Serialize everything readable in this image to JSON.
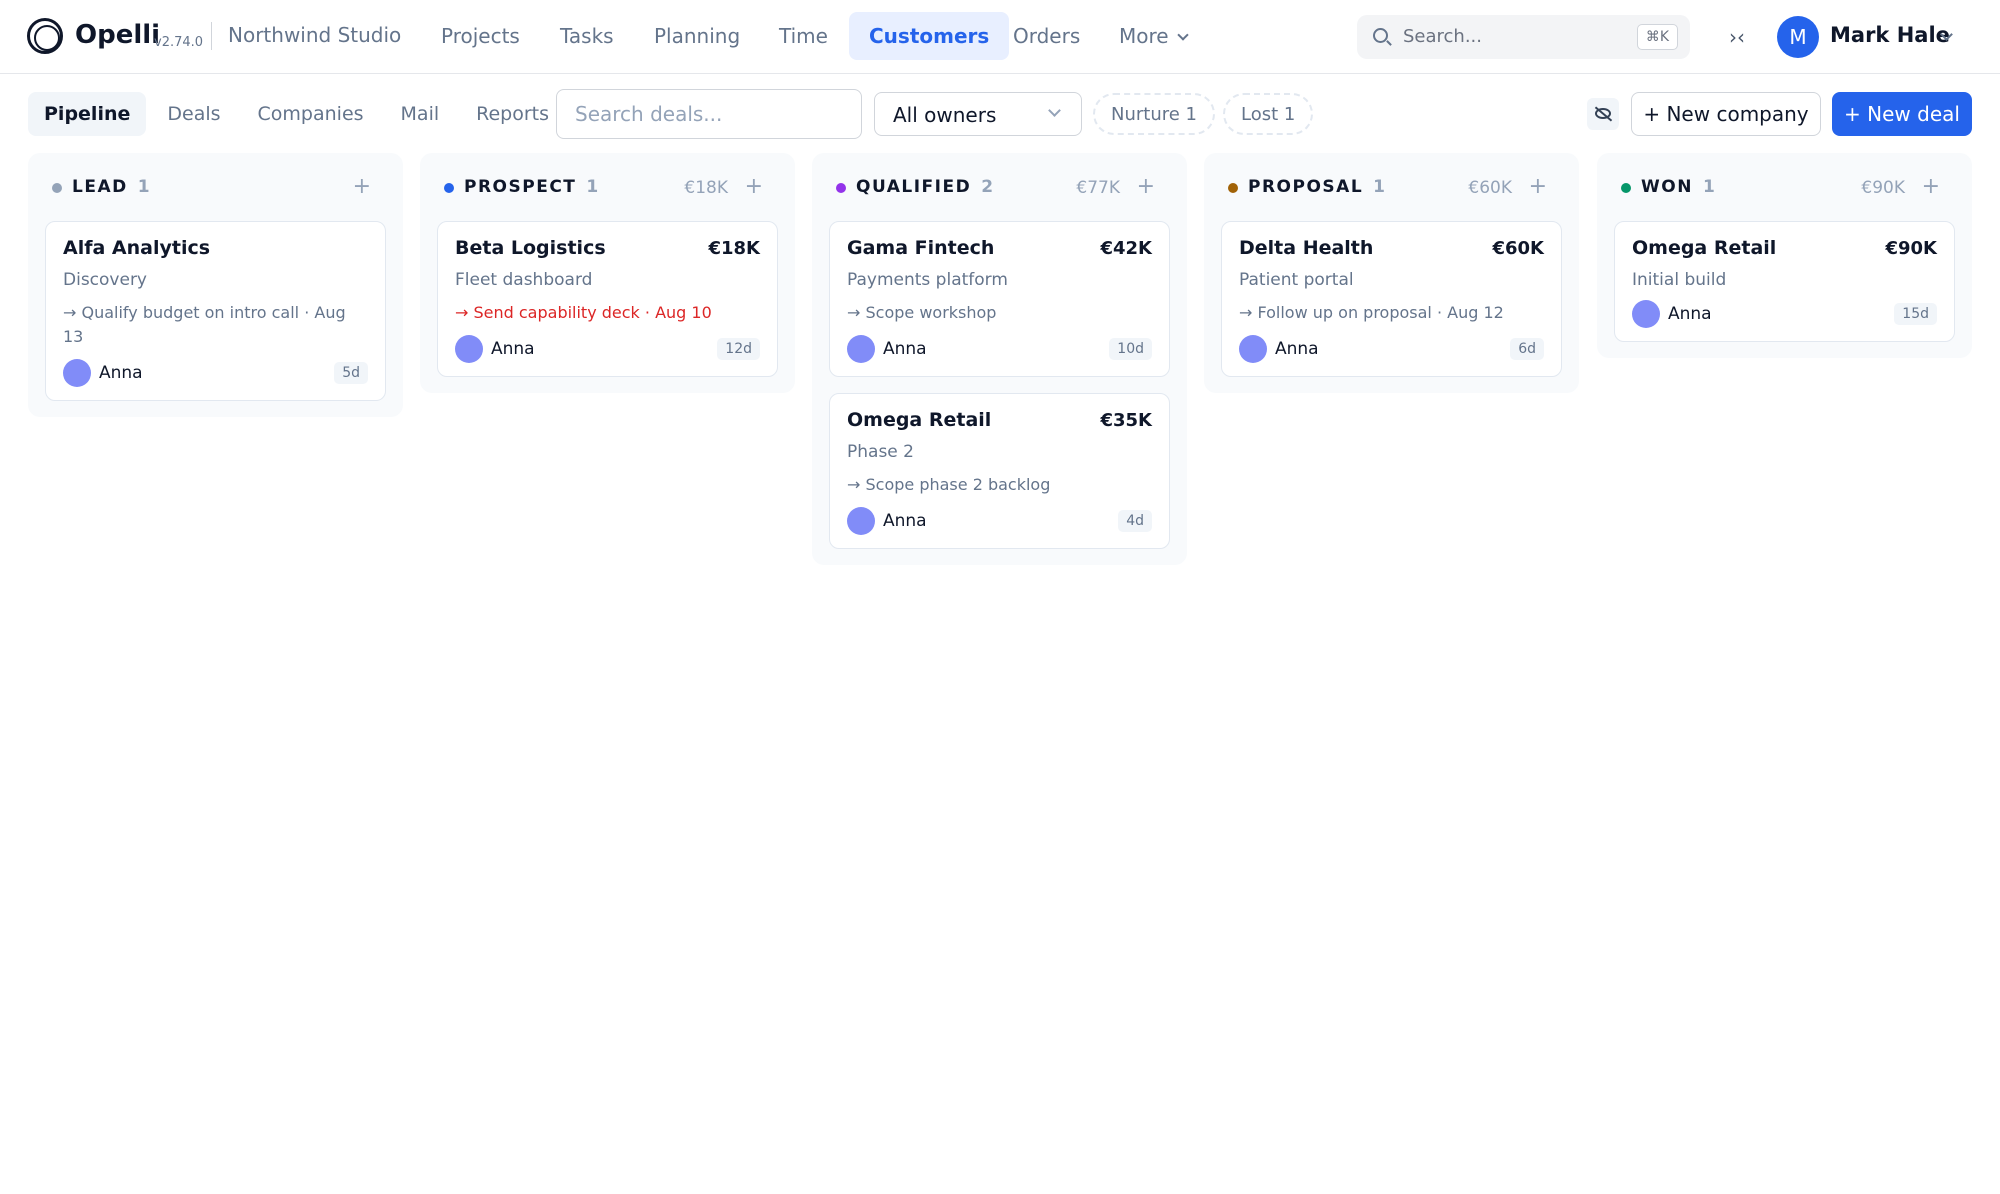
{
  "app": {
    "name": "Opelli",
    "version": "v2.74.0",
    "workspace": "Northwind Studio"
  },
  "nav": {
    "items": [
      {
        "label": "Projects"
      },
      {
        "label": "Tasks"
      },
      {
        "label": "Planning"
      },
      {
        "label": "Time"
      },
      {
        "label": "Customers"
      },
      {
        "label": "Orders"
      },
      {
        "label": "More"
      }
    ],
    "active": "Customers"
  },
  "search": {
    "placeholder": "Search...",
    "shortcut": "⌘K"
  },
  "user": {
    "initial": "M",
    "name": "Mark Hale"
  },
  "subtabs": {
    "items": [
      {
        "label": "Pipeline"
      },
      {
        "label": "Deals"
      },
      {
        "label": "Companies"
      },
      {
        "label": "Mail"
      },
      {
        "label": "Reports"
      }
    ],
    "active": "Pipeline"
  },
  "toolbar": {
    "deal_search_placeholder": "Search deals...",
    "owner_filter": "All owners",
    "pills": [
      {
        "label": "Nurture 1"
      },
      {
        "label": "Lost 1"
      }
    ],
    "new_company_label": "+ New company",
    "new_deal_label": "+ New deal"
  },
  "colors": {
    "accent": "#2563eb",
    "lead": "#94a3b8",
    "prospect": "#2563eb",
    "qualified": "#9333ea",
    "proposal": "#a16207",
    "won": "#059669",
    "overdue": "#dc2626"
  },
  "columns": [
    {
      "name": "LEAD",
      "count": "1",
      "amount": "",
      "cards": [
        {
          "title": "Alfa Analytics",
          "amount": "",
          "subtitle": "Discovery",
          "task": "→ Qualify budget on intro call · Aug 13",
          "owner": "Anna",
          "age": "5d",
          "overdue": false
        }
      ]
    },
    {
      "name": "PROSPECT",
      "count": "1",
      "amount": "€18K",
      "cards": [
        {
          "title": "Beta Logistics",
          "amount": "€18K",
          "subtitle": "Fleet dashboard",
          "task": "→ Send capability deck · Aug 10",
          "owner": "Anna",
          "age": "12d",
          "overdue": true
        }
      ]
    },
    {
      "name": "QUALIFIED",
      "count": "2",
      "amount": "€77K",
      "cards": [
        {
          "title": "Gama Fintech",
          "amount": "€42K",
          "subtitle": "Payments platform",
          "task": "→ Scope workshop",
          "owner": "Anna",
          "age": "10d",
          "overdue": false
        },
        {
          "title": "Omega Retail",
          "amount": "€35K",
          "subtitle": "Phase 2",
          "task": "→ Scope phase 2 backlog",
          "owner": "Anna",
          "age": "4d",
          "overdue": false
        }
      ]
    },
    {
      "name": "PROPOSAL",
      "count": "1",
      "amount": "€60K",
      "cards": [
        {
          "title": "Delta Health",
          "amount": "€60K",
          "subtitle": "Patient portal",
          "task": "→ Follow up on proposal · Aug 12",
          "owner": "Anna",
          "age": "6d",
          "overdue": false
        }
      ]
    },
    {
      "name": "WON",
      "count": "1",
      "amount": "€90K",
      "cards": [
        {
          "title": "Omega Retail",
          "amount": "€90K",
          "subtitle": "Initial build",
          "task": "",
          "owner": "Anna",
          "age": "15d",
          "overdue": false
        }
      ]
    }
  ]
}
